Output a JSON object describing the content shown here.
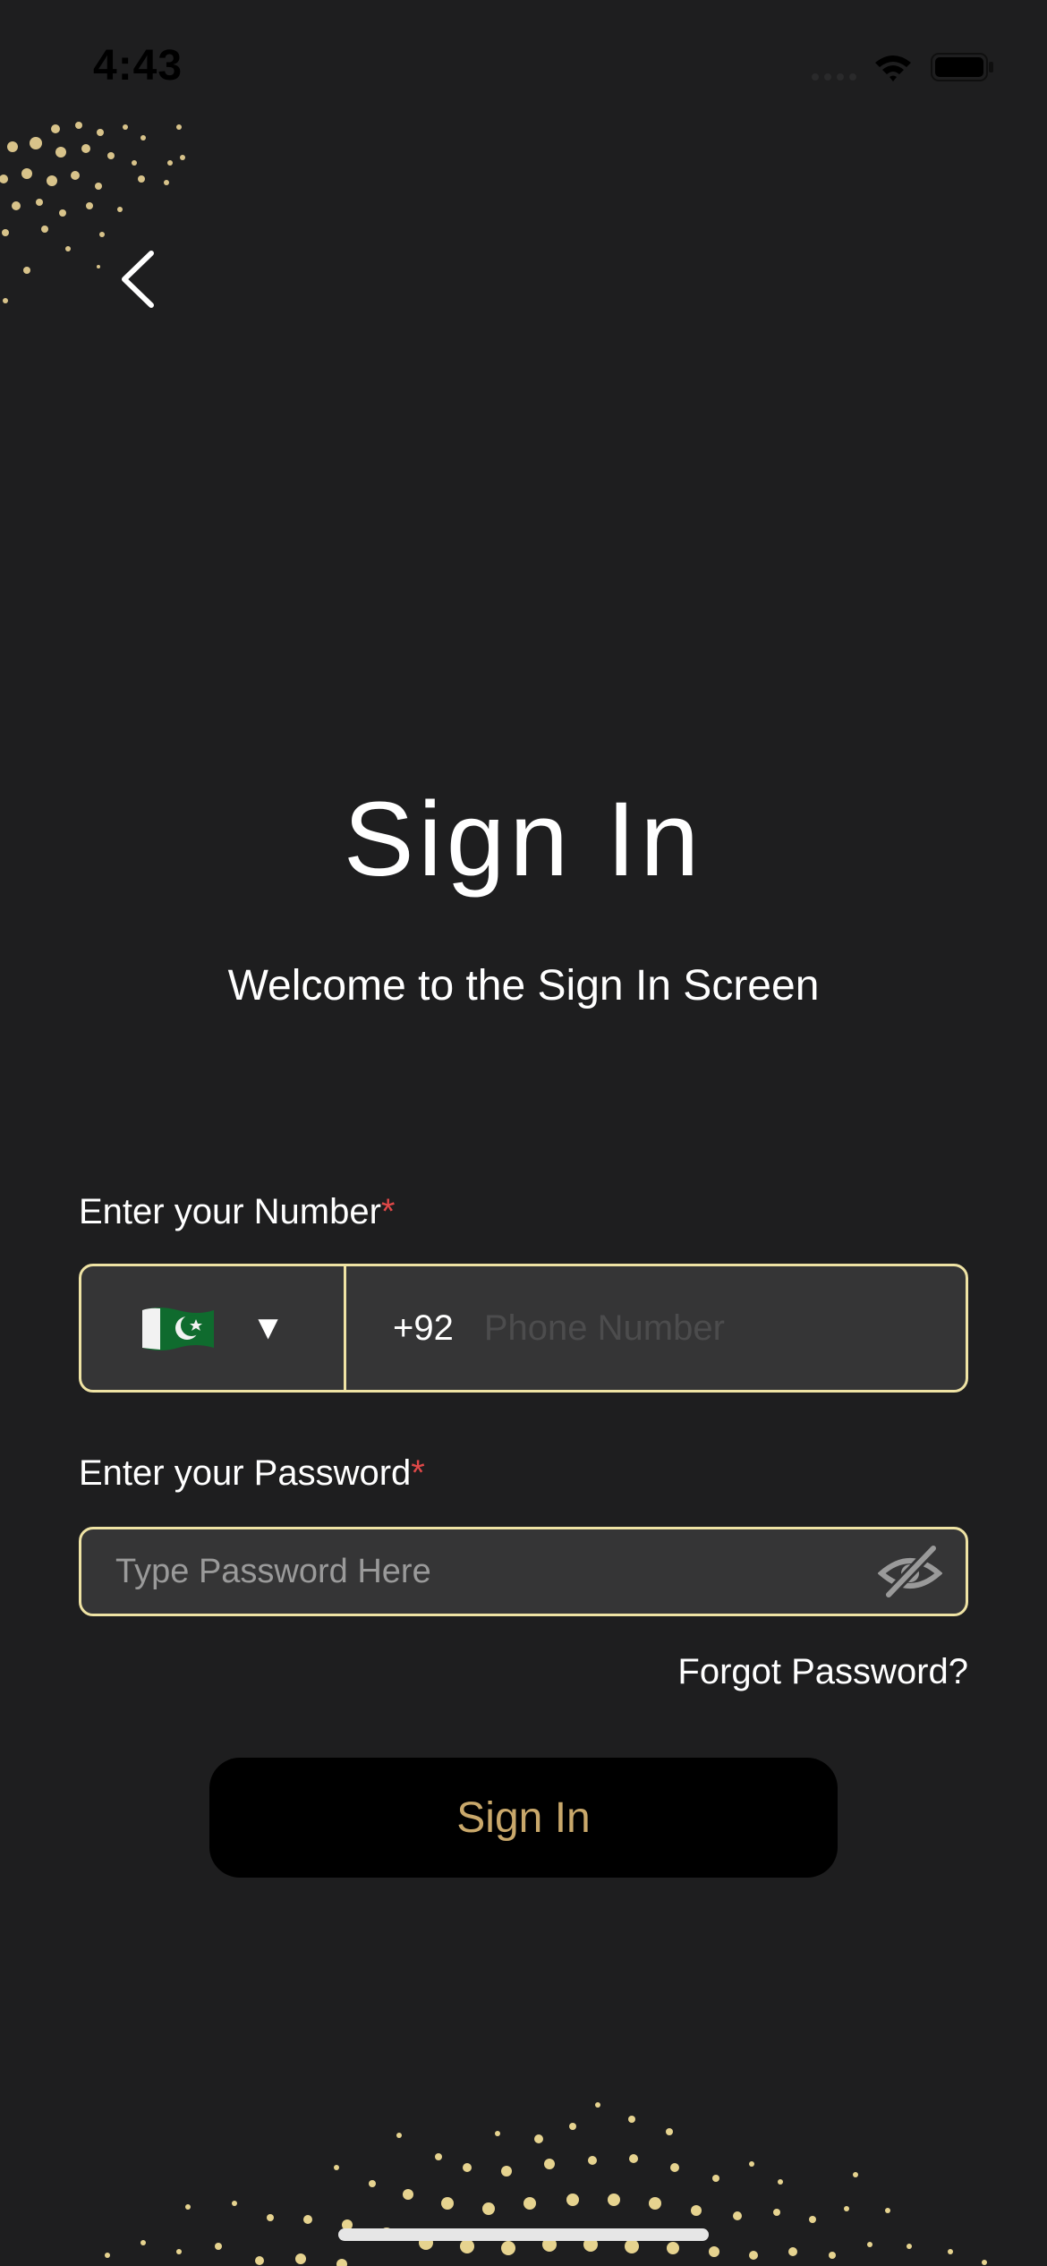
{
  "status_bar": {
    "time": "4:43"
  },
  "header": {
    "back_icon": "chevron-left-icon"
  },
  "title": "Sign In",
  "subtitle": "Welcome to the Sign In Screen",
  "number_field": {
    "label": "Enter your Number",
    "required_mark": "*",
    "country_flag_icon": "pakistan-flag-icon",
    "dropdown_icon": "triangle-down-icon",
    "dropdown_caret": "▼",
    "dial_code": "+92",
    "placeholder": "Phone Number",
    "value": ""
  },
  "password_field": {
    "label": "Enter your Password",
    "required_mark": "*",
    "placeholder": "Type Password Here",
    "value": "",
    "visibility_icon": "eye-off-icon"
  },
  "forgot_password": "Forgot Password?",
  "sign_in_button": "Sign In",
  "colors": {
    "background": "#1e1e1f",
    "field_border": "#efe3a4",
    "field_bg": "#353536",
    "accent_gold": "#c9a86b",
    "required": "#e04848"
  }
}
